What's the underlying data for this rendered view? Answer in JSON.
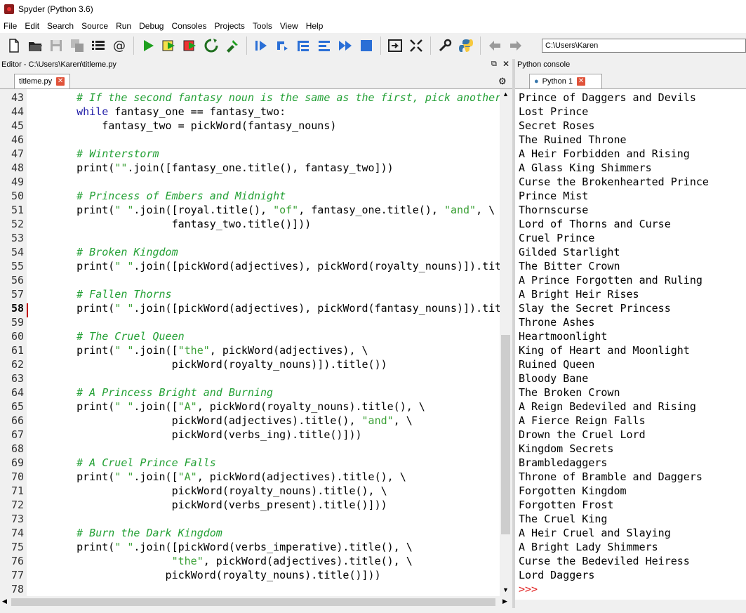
{
  "window": {
    "title": "Spyder (Python 3.6)"
  },
  "menu": [
    "File",
    "Edit",
    "Search",
    "Source",
    "Run",
    "Debug",
    "Consoles",
    "Projects",
    "Tools",
    "View",
    "Help"
  ],
  "toolbar": {
    "working_dir": "C:\\Users\\Karen"
  },
  "editor": {
    "pane_title": "Editor - C:\\Users\\Karen\\titleme.py",
    "tab_label": "titleme.py",
    "current_line": 58,
    "lines": [
      {
        "n": "43",
        "parts": [
          {
            "t": "    "
          },
          {
            "c": "cmt",
            "t": "# If the second fantasy noun is the same as the first, pick another."
          }
        ]
      },
      {
        "n": "44",
        "parts": [
          {
            "t": "    "
          },
          {
            "c": "kw",
            "t": "while"
          },
          {
            "t": " fantasy_one == fantasy_two:"
          }
        ]
      },
      {
        "n": "45",
        "parts": [
          {
            "t": "        fantasy_two = pickWord(fantasy_nouns)"
          }
        ]
      },
      {
        "n": "46",
        "parts": []
      },
      {
        "n": "47",
        "parts": [
          {
            "t": "    "
          },
          {
            "c": "cmt",
            "t": "# Winterstorm"
          }
        ]
      },
      {
        "n": "48",
        "parts": [
          {
            "t": "    print("
          },
          {
            "c": "str",
            "t": "\"\""
          },
          {
            "t": ".join([fantasy_one.title(), fantasy_two]))"
          }
        ]
      },
      {
        "n": "49",
        "parts": []
      },
      {
        "n": "50",
        "parts": [
          {
            "t": "    "
          },
          {
            "c": "cmt",
            "t": "# Princess of Embers and Midnight"
          }
        ]
      },
      {
        "n": "51",
        "parts": [
          {
            "t": "    print("
          },
          {
            "c": "str",
            "t": "\" \""
          },
          {
            "t": ".join([royal.title(), "
          },
          {
            "c": "str",
            "t": "\"of\""
          },
          {
            "t": ", fantasy_one.title(), "
          },
          {
            "c": "str",
            "t": "\"and\""
          },
          {
            "t": ", \\"
          }
        ]
      },
      {
        "n": "52",
        "parts": [
          {
            "t": "                   fantasy_two.title()]))"
          }
        ]
      },
      {
        "n": "53",
        "parts": []
      },
      {
        "n": "54",
        "parts": [
          {
            "t": "    "
          },
          {
            "c": "cmt",
            "t": "# Broken Kingdom"
          }
        ]
      },
      {
        "n": "55",
        "parts": [
          {
            "t": "    print("
          },
          {
            "c": "str",
            "t": "\" \""
          },
          {
            "t": ".join([pickWord(adjectives), pickWord(royalty_nouns)]).title("
          }
        ]
      },
      {
        "n": "56",
        "parts": []
      },
      {
        "n": "57",
        "parts": [
          {
            "t": "    "
          },
          {
            "c": "cmt",
            "t": "# Fallen Thorns"
          }
        ]
      },
      {
        "n": "58",
        "parts": [
          {
            "t": "    print("
          },
          {
            "c": "str",
            "t": "\" \""
          },
          {
            "t": ".join([pickWord(adjectives), pickWord(fantasy_nouns)]).title("
          }
        ]
      },
      {
        "n": "59",
        "parts": []
      },
      {
        "n": "60",
        "parts": [
          {
            "t": "    "
          },
          {
            "c": "cmt",
            "t": "# The Cruel Queen"
          }
        ]
      },
      {
        "n": "61",
        "parts": [
          {
            "t": "    print("
          },
          {
            "c": "str",
            "t": "\" \""
          },
          {
            "t": ".join(["
          },
          {
            "c": "str",
            "t": "\"the\""
          },
          {
            "t": ", pickWord(adjectives), \\"
          }
        ]
      },
      {
        "n": "62",
        "parts": [
          {
            "t": "                   pickWord(royalty_nouns)]).title())"
          }
        ]
      },
      {
        "n": "63",
        "parts": []
      },
      {
        "n": "64",
        "parts": [
          {
            "t": "    "
          },
          {
            "c": "cmt",
            "t": "# A Princess Bright and Burning"
          }
        ]
      },
      {
        "n": "65",
        "parts": [
          {
            "t": "    print("
          },
          {
            "c": "str",
            "t": "\" \""
          },
          {
            "t": ".join(["
          },
          {
            "c": "str",
            "t": "\"A\""
          },
          {
            "t": ", pickWord(royalty_nouns).title(), \\"
          }
        ]
      },
      {
        "n": "66",
        "parts": [
          {
            "t": "                   pickWord(adjectives).title(), "
          },
          {
            "c": "str",
            "t": "\"and\""
          },
          {
            "t": ", \\"
          }
        ]
      },
      {
        "n": "67",
        "parts": [
          {
            "t": "                   pickWord(verbs_ing).title()]))"
          }
        ]
      },
      {
        "n": "68",
        "parts": []
      },
      {
        "n": "69",
        "parts": [
          {
            "t": "    "
          },
          {
            "c": "cmt",
            "t": "# A Cruel Prince Falls"
          }
        ]
      },
      {
        "n": "70",
        "parts": [
          {
            "t": "    print("
          },
          {
            "c": "str",
            "t": "\" \""
          },
          {
            "t": ".join(["
          },
          {
            "c": "str",
            "t": "\"A\""
          },
          {
            "t": ", pickWord(adjectives).title(), \\"
          }
        ]
      },
      {
        "n": "71",
        "parts": [
          {
            "t": "                   pickWord(royalty_nouns).title(), \\"
          }
        ]
      },
      {
        "n": "72",
        "parts": [
          {
            "t": "                   pickWord(verbs_present).title()]))"
          }
        ]
      },
      {
        "n": "73",
        "parts": []
      },
      {
        "n": "74",
        "parts": [
          {
            "t": "    "
          },
          {
            "c": "cmt",
            "t": "# Burn the Dark Kingdom"
          }
        ]
      },
      {
        "n": "75",
        "parts": [
          {
            "t": "    print("
          },
          {
            "c": "str",
            "t": "\" \""
          },
          {
            "t": ".join([pickWord(verbs_imperative).title(), \\"
          }
        ]
      },
      {
        "n": "76",
        "parts": [
          {
            "t": "                   "
          },
          {
            "c": "str",
            "t": "\"the\""
          },
          {
            "t": ", pickWord(adjectives).title(), \\"
          }
        ]
      },
      {
        "n": "77",
        "parts": [
          {
            "t": "                  pickWord(royalty_nouns).title()]))"
          }
        ]
      },
      {
        "n": "78",
        "parts": []
      }
    ]
  },
  "console": {
    "pane_title": "Python console",
    "tab_label": "Python 1",
    "output": [
      "Prince of Daggers and Devils",
      "Lost Prince",
      "Secret Roses",
      "The Ruined Throne",
      "A Heir Forbidden and Rising",
      "A Glass King Shimmers",
      "Curse the Brokenhearted Prince",
      "Prince Mist",
      "Thornscurse",
      "Lord of Thorns and Curse",
      "Cruel Prince",
      "Gilded Starlight",
      "The Bitter Crown",
      "A Prince Forgotten and Ruling",
      "A Bright Heir Rises",
      "Slay the Secret Princess",
      "Throne Ashes",
      "Heartmoonlight",
      "King of Heart and Moonlight",
      "Ruined Queen",
      "Bloody Bane",
      "The Broken Crown",
      "A Reign Bedeviled and Rising",
      "A Fierce Reign Falls",
      "Drown the Cruel Lord",
      "Kingdom Secrets",
      "Brambledaggers",
      "Throne of Bramble and Daggers",
      "Forgotten Kingdom",
      "Forgotten Frost",
      "The Cruel King",
      "A Heir Cruel and Slaying",
      "A Bright Lady Shimmers",
      "Curse the Bedeviled Heiress",
      "Lord Daggers"
    ],
    "prompt": ">>>"
  },
  "colors": {
    "comment": "#23a035",
    "keyword": "#1f1ba6",
    "string": "#3aa035",
    "prompt": "#e02020"
  }
}
